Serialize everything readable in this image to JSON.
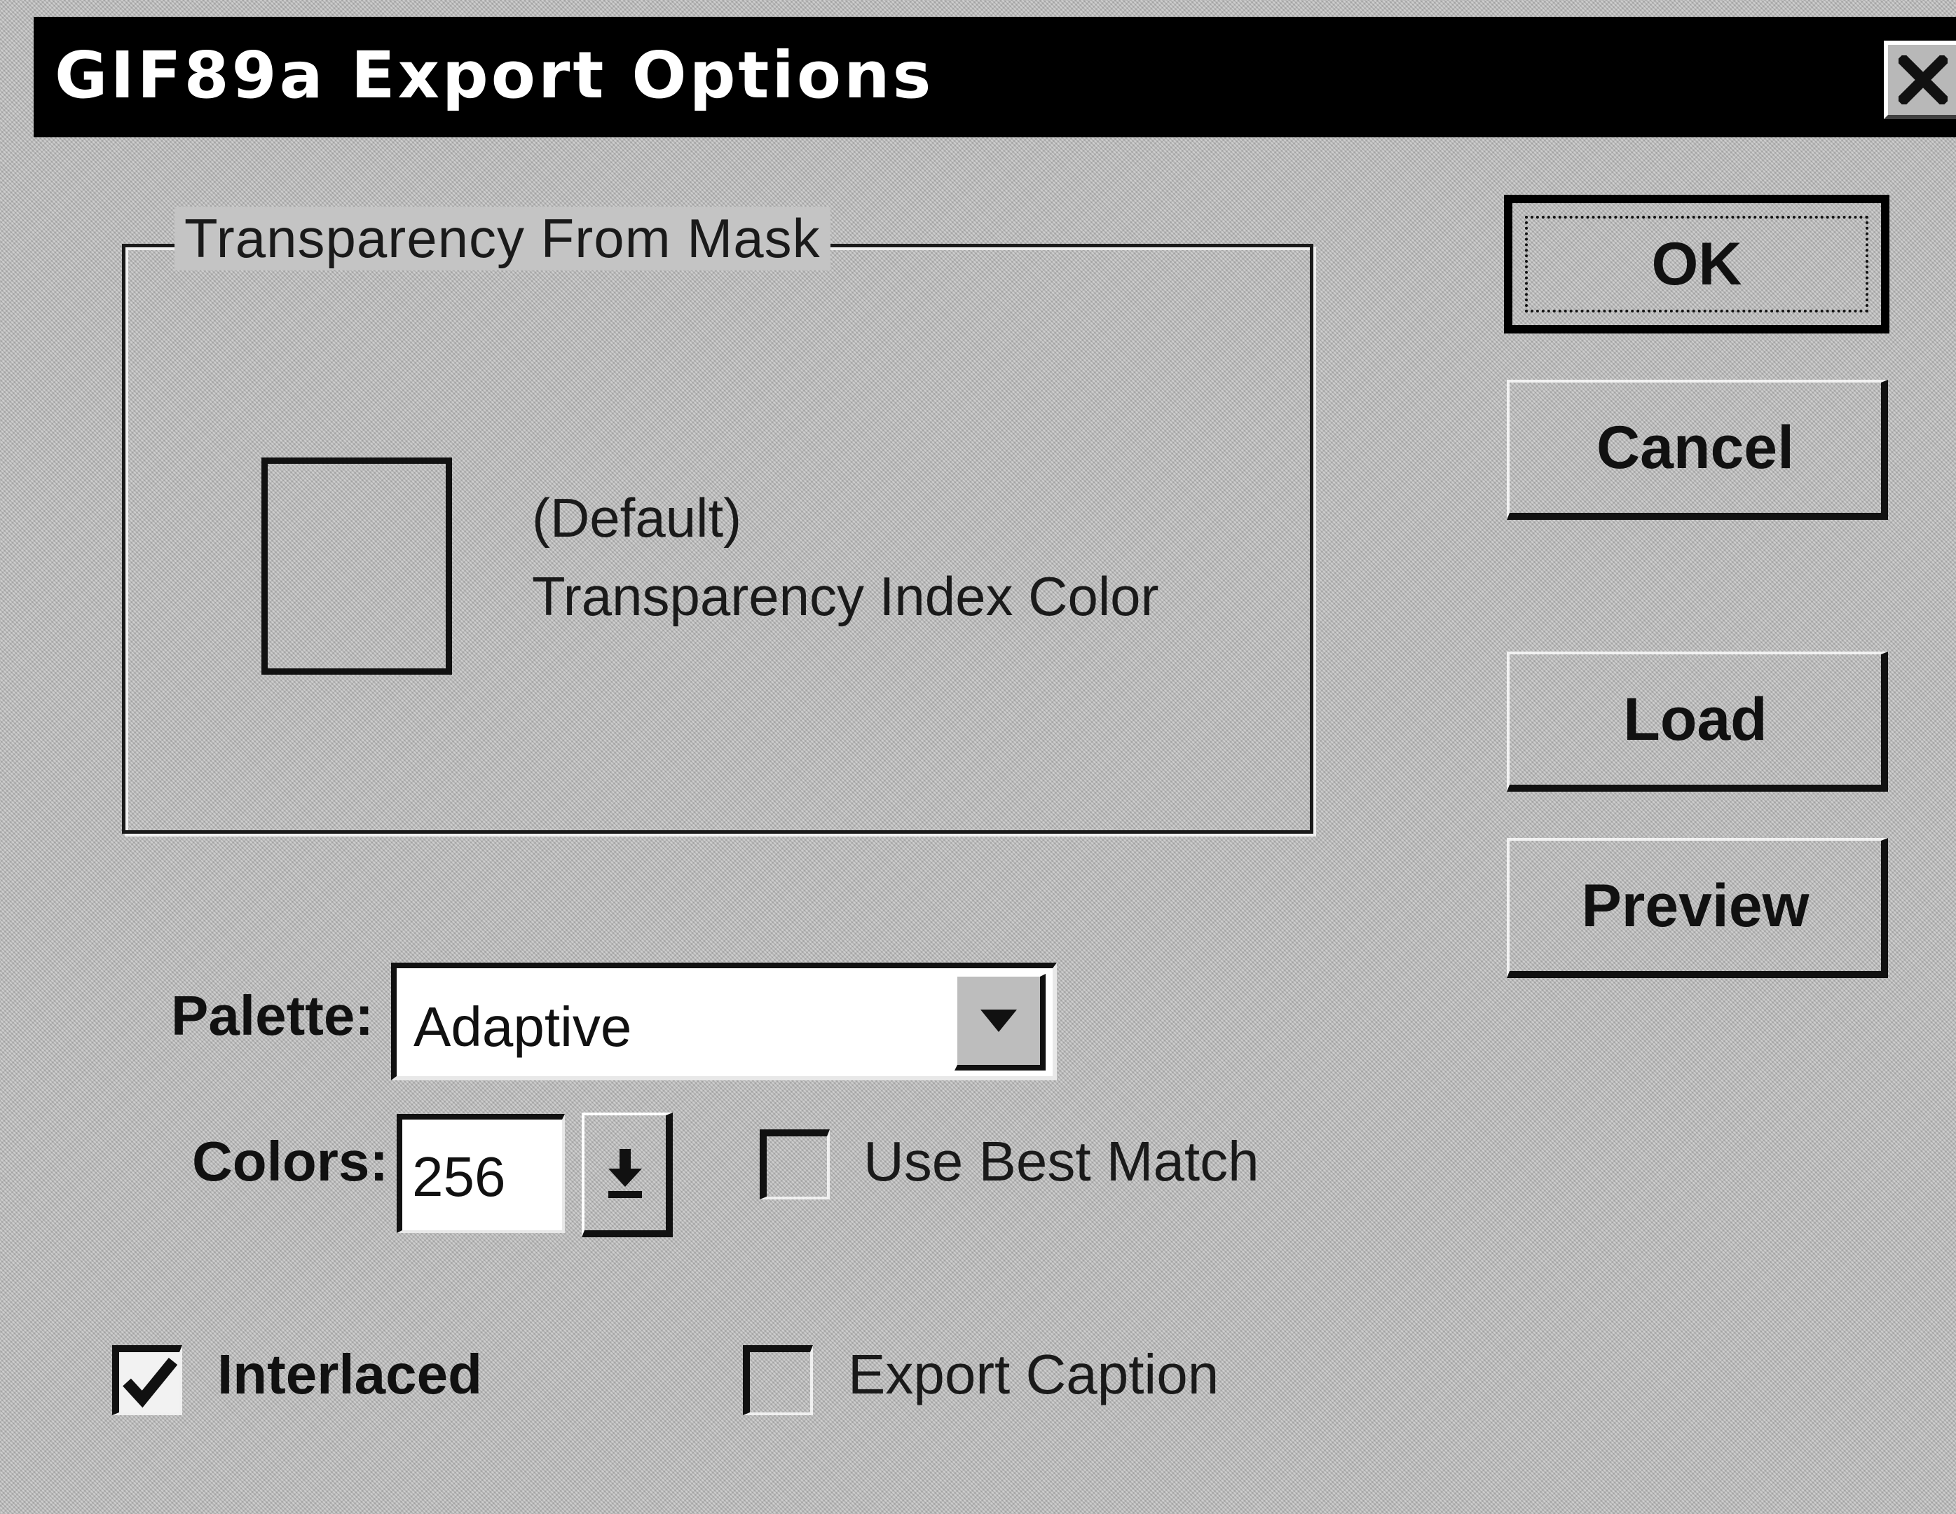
{
  "dialog": {
    "title": "GIF89a Export Options",
    "close_icon": "close-icon"
  },
  "transparency": {
    "group_label": "Transparency From Mask",
    "swatch_line1": "(Default)",
    "swatch_line2": "Transparency Index Color"
  },
  "buttons": {
    "ok": "OK",
    "cancel": "Cancel",
    "load": "Load",
    "preview": "Preview"
  },
  "palette": {
    "label": "Palette:",
    "value": "Adaptive"
  },
  "colors": {
    "label": "Colors:",
    "value": "256"
  },
  "options": {
    "use_best_match": {
      "label": "Use Best Match",
      "checked": false
    },
    "interlaced": {
      "label": "Interlaced",
      "checked": true
    },
    "export_caption": {
      "label": "Export Caption",
      "checked": false
    }
  }
}
